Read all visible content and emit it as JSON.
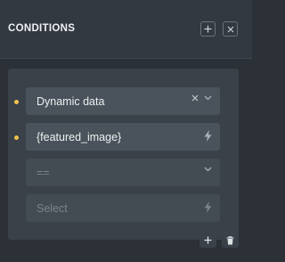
{
  "header": {
    "title": "CONDITIONS",
    "add_icon": "plus-icon",
    "close_icon": "close-icon"
  },
  "condition": {
    "key_select": {
      "value": "Dynamic data"
    },
    "dynamic_tag": {
      "value": "{featured_image}"
    },
    "operator_select": {
      "value": "=="
    },
    "value_field": {
      "placeholder": "Select"
    }
  },
  "footer": {
    "add_icon": "plus-icon",
    "delete_icon": "trash-icon"
  },
  "colors": {
    "background": "#2b3137",
    "panel": "#3a4148",
    "field": "#4a535b",
    "active_dot": "#f0c24d"
  }
}
